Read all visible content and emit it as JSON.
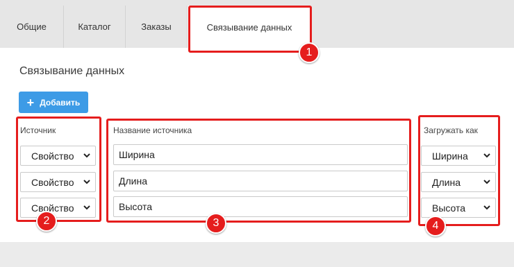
{
  "tabs": [
    {
      "label": "Общие"
    },
    {
      "label": "Каталог"
    },
    {
      "label": "Заказы"
    },
    {
      "label": "Связывание данных"
    }
  ],
  "section_title": "Связывание данных",
  "add_button_label": "Добавить",
  "columns": {
    "source": "Источник",
    "source_name": "Название источника",
    "load_as": "Загружать как"
  },
  "rows": [
    {
      "source": "Свойство",
      "name": "Ширина",
      "load_as": "Ширина"
    },
    {
      "source": "Свойство",
      "name": "Длина",
      "load_as": "Длина"
    },
    {
      "source": "Свойство",
      "name": "Высота",
      "load_as": "Высота"
    }
  ],
  "badges": [
    "1",
    "2",
    "3",
    "4"
  ],
  "colors": {
    "accent": "#3d9be6",
    "highlight": "#e51d1d"
  }
}
